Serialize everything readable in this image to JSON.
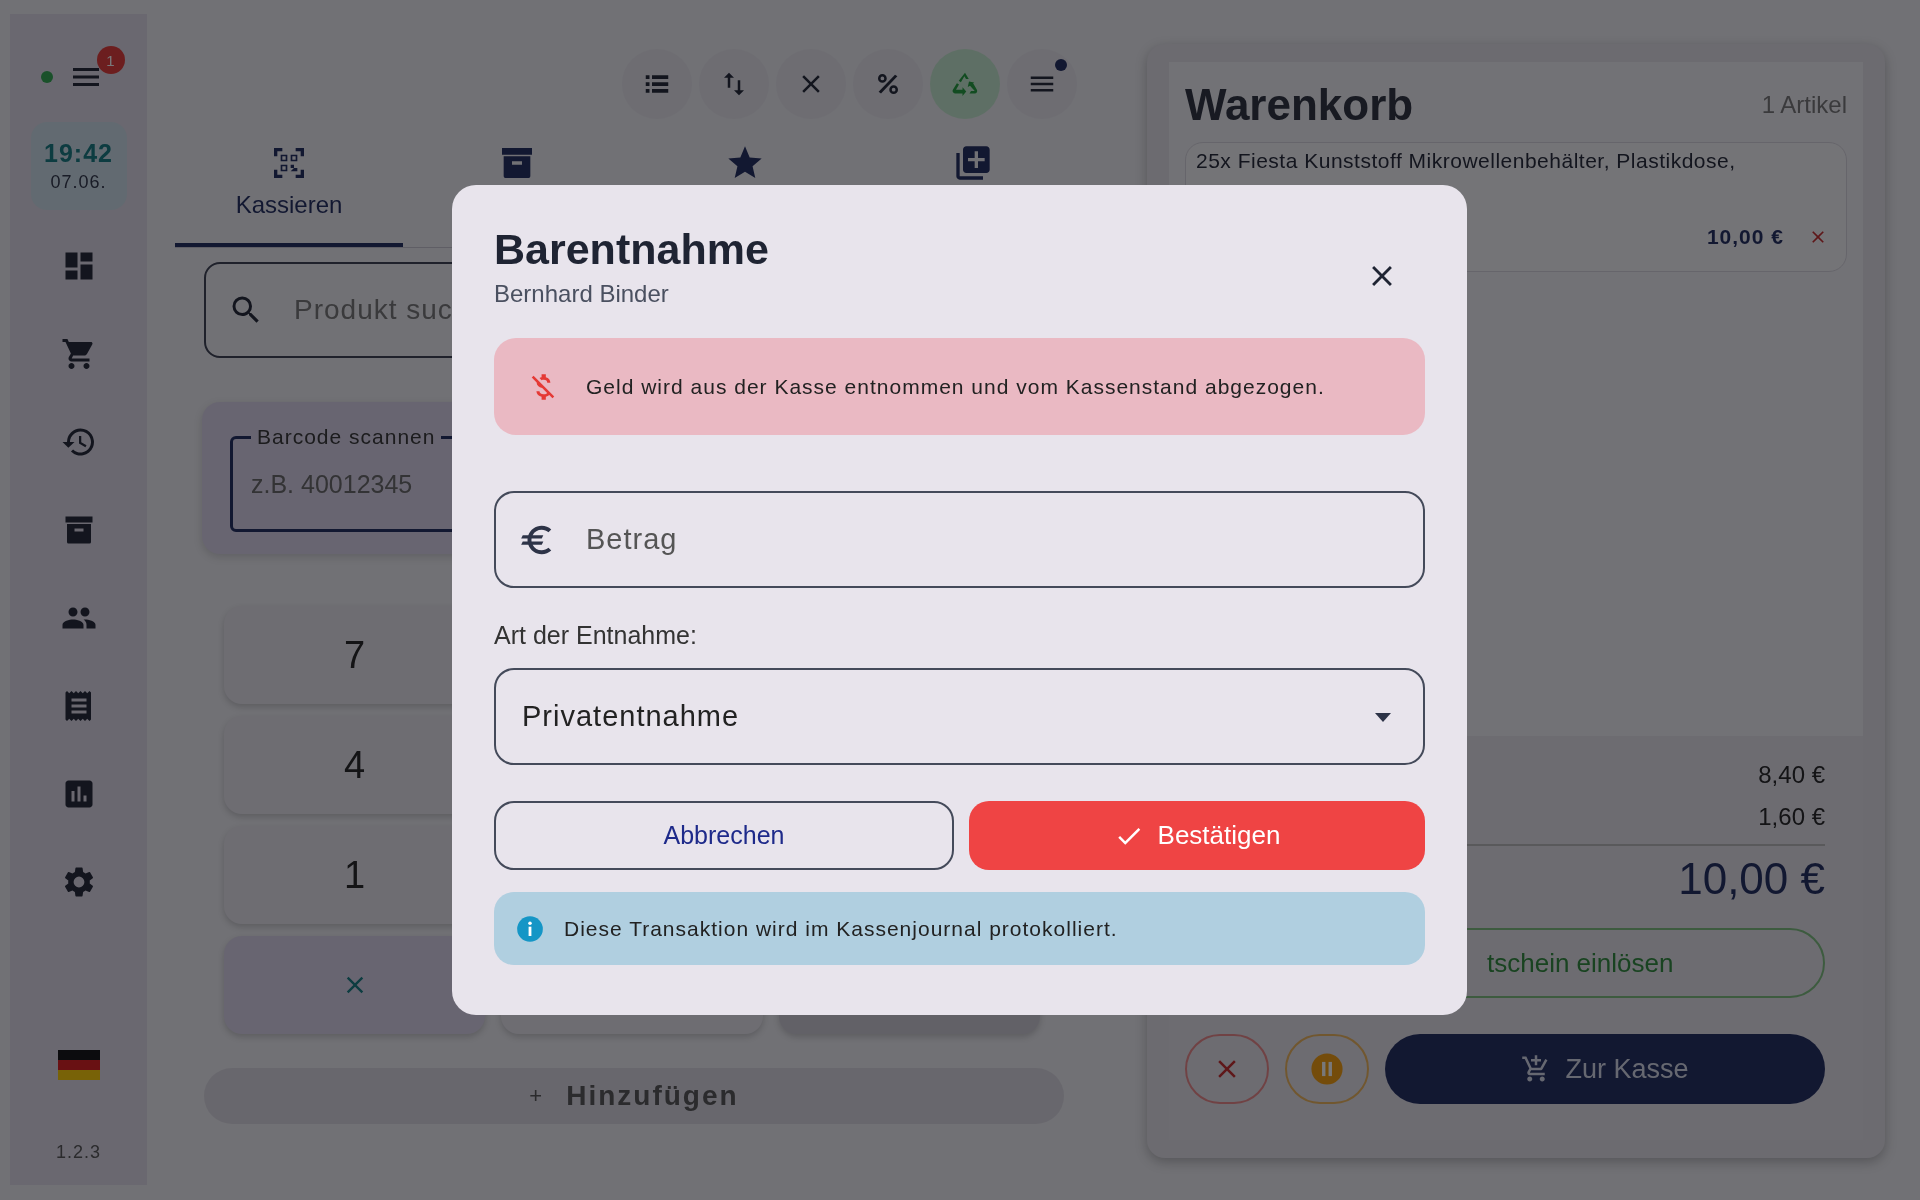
{
  "sidebar": {
    "online": true,
    "menu_badge": "1",
    "clock": {
      "time": "19:42",
      "date": "07.06."
    },
    "version": "1.2.3"
  },
  "toolbar": [
    {
      "on": false
    },
    {
      "on": false
    },
    {
      "on": false
    },
    {
      "on": false
    },
    {
      "on": true
    },
    {
      "on": false,
      "dot": true
    }
  ],
  "tabs": [
    {
      "kind": "scan",
      "label": "Kassieren",
      "selected": true
    },
    {
      "kind": "archive",
      "selected": false
    },
    {
      "kind": "favorites"
    },
    {
      "kind": "new"
    }
  ],
  "search": {
    "placeholder": "Produkt suc"
  },
  "barcode": {
    "label": "Barcode scannen",
    "placeholder": "z.B. 40012345"
  },
  "keypad": [
    "7",
    "4",
    "1"
  ],
  "add_bar": {
    "icon": "+",
    "label": "Hinzufügen"
  },
  "cart": {
    "title": "Warenkorb",
    "count": "1 Artikel",
    "items": [
      {
        "name": "25x Fiesta Kunststoff Mikrowellenbehälter, Plastikdose,",
        "price": "10,00 €"
      }
    ],
    "summary": [
      "8,40 €",
      "1,60 €"
    ],
    "total": "10,00 €",
    "voucher": "tschein einlösen",
    "checkout": "Zur Kasse"
  },
  "dialog": {
    "title": "Barentnahme",
    "subtitle": "Bernhard Binder",
    "warning": "Geld wird aus der Kasse entnommen und vom Kassenstand abgezogen.",
    "amount": {
      "placeholder": "Betrag"
    },
    "type_label": "Art der Entnahme:",
    "type": {
      "value": "Privatentnahme"
    },
    "cancel": "Abbrechen",
    "confirm": "Bestätigen",
    "info": "Diese Transaktion wird im Kassenjournal protokolliert."
  }
}
